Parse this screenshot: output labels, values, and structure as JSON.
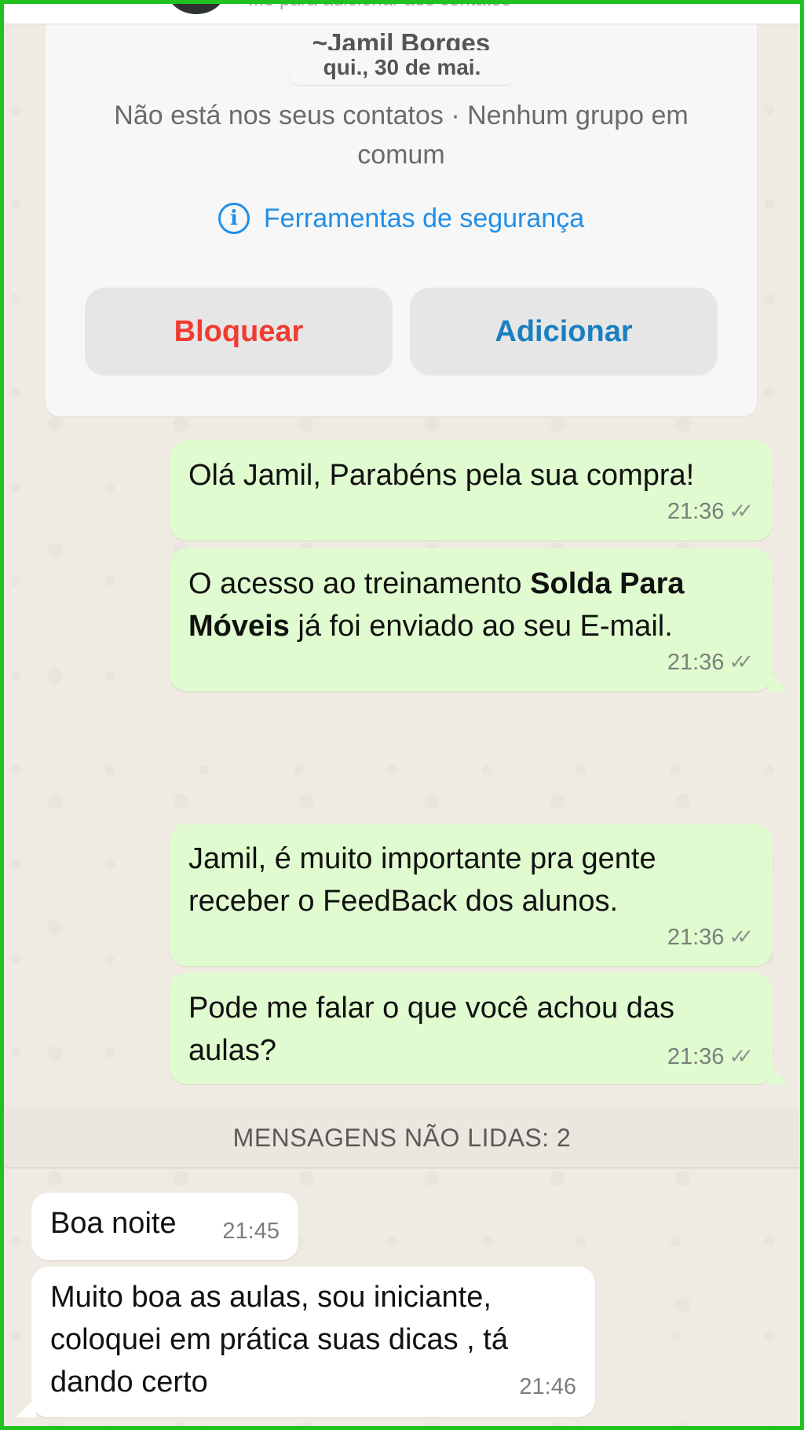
{
  "header": {
    "add_hint": "...o para adicionar aos contatos"
  },
  "contact_card": {
    "name": "~Jamil Borges",
    "date": "qui., 30 de mai.",
    "info": "Não está nos seus contatos · Nenhum grupo em comum",
    "safety_tools": "Ferramentas de segurança",
    "block_label": "Bloquear",
    "add_label": "Adicionar"
  },
  "messages": [
    {
      "direction": "outgoing",
      "text": "Olá Jamil, Parabéns pela sua compra!",
      "time": "21:36"
    },
    {
      "direction": "outgoing",
      "text_before": "O acesso ao treinamento ",
      "text_bold": "Solda Para Móveis",
      "text_after": " já foi enviado ao seu E-mail.",
      "time": "21:36"
    },
    {
      "direction": "outgoing",
      "text": "Jamil, é muito importante pra gente receber o FeedBack dos alunos.",
      "time": "21:36"
    },
    {
      "direction": "outgoing",
      "text": "Pode me falar o que você achou das aulas?",
      "time": "21:36"
    },
    {
      "direction": "incoming",
      "text": "Boa noite",
      "time": "21:45"
    },
    {
      "direction": "incoming",
      "text": "Muito boa as aulas, sou iniciante, coloquei em prática suas dicas , tá dando certo",
      "time": "21:46"
    }
  ],
  "unread_divider": "MENSAGENS NÃO LIDAS: 2",
  "colors": {
    "outgoing_bubble": "#e0fbcf",
    "incoming_bubble": "#ffffff",
    "block_text": "#f23b30",
    "add_text": "#1a7fbf",
    "link_blue": "#1f8fe8"
  }
}
